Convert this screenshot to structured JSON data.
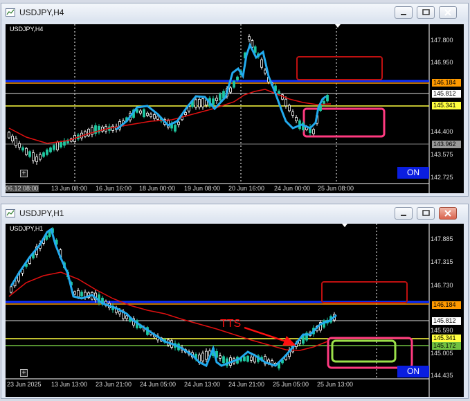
{
  "windows": [
    {
      "id": "h4",
      "title": "USDJPY,H4",
      "symbol": "USDJPY,H4",
      "on_label": "ON",
      "price_labels": [
        "147.800",
        "146.950",
        "145.341",
        "144.400",
        "143.962",
        "143.575",
        "142.725"
      ],
      "tags": {
        "orange": "146.184",
        "white": "145.812",
        "yellow": "145.341",
        "gray": "143.962"
      },
      "time_labels": [
        "06.12 08:00",
        "13 Jun 08:00",
        "16 Jun 16:00",
        "18 Jun 00:00",
        "19 Jun 08:00",
        "20 Jun 16:00",
        "24 Jun 00:00",
        "25 Jun 08:00"
      ],
      "colors": {
        "blue_line": "#1030ff",
        "orange_line": "#ff9a00",
        "yellow_line": "#ffff40",
        "ma_line": "#e01010",
        "trace_line": "#22aaee",
        "box_red": "#c01010",
        "box_pink": "#ff3a80"
      }
    },
    {
      "id": "h1",
      "title": "USDJPY,H1",
      "symbol": "USDJPY,H1",
      "on_label": "ON",
      "price_labels": [
        "147.885",
        "147.315",
        "146.730",
        "145.590",
        "145.005",
        "144.435"
      ],
      "tags": {
        "orange": "146.184",
        "white": "145.812",
        "yellow": "145.341",
        "green": "145.172"
      },
      "time_labels": [
        "23 Jun 2025",
        "13 Jun 13:00",
        "23 Jun 21:00",
        "24 Jun 05:00",
        "24 Jun 13:00",
        "24 Jun 21:00",
        "25 Jun 05:00",
        "25 Jun 13:00"
      ],
      "annotation": "TTS",
      "colors": {
        "blue_line": "#1030ff",
        "orange_line": "#ff9a00",
        "yellow_line": "#ffff40",
        "green_line": "#70c040",
        "ma_line": "#e01010",
        "trace_line": "#22aaee",
        "box_red": "#c01010",
        "box_pink": "#ff3a80",
        "box_green": "#9be04a"
      }
    }
  ]
}
